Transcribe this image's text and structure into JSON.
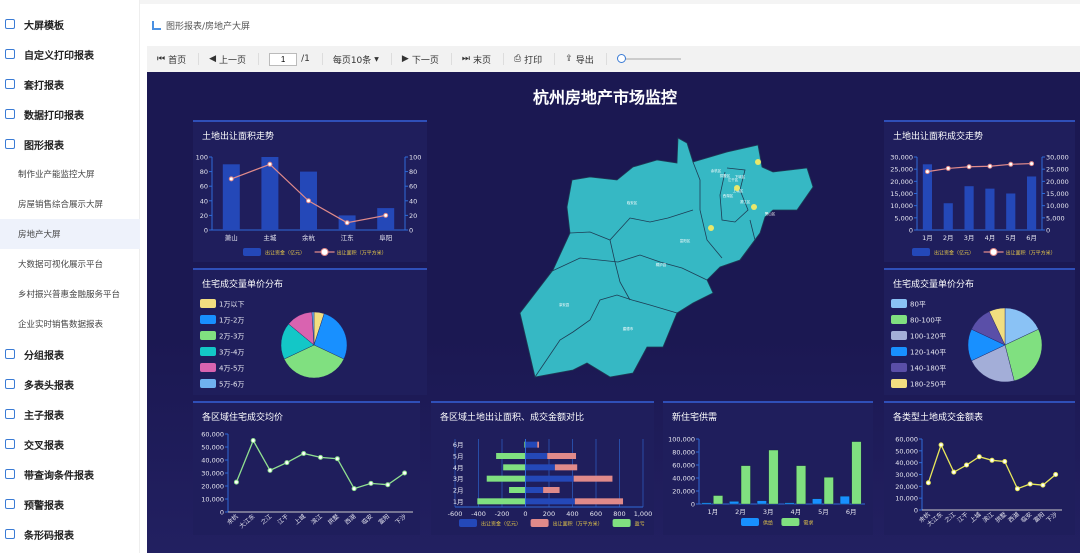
{
  "sidebar": {
    "items": [
      {
        "label": "大屏模板",
        "icon": "screen-icon"
      },
      {
        "label": "自定义打印报表",
        "icon": "refresh-icon"
      },
      {
        "label": "套打报表",
        "icon": "printer-icon"
      },
      {
        "label": "数据打印报表",
        "icon": "database-icon"
      },
      {
        "label": "图形报表",
        "icon": "bar-chart-icon"
      }
    ],
    "sub_items": [
      "制作业产能监控大屏",
      "房屋销售综合展示大屏",
      "房地产大屏",
      "大数据可视化展示平台",
      "乡村振兴普惠金融服务平台",
      "企业实时销售数据报表"
    ],
    "active_sub": "房地产大屏",
    "items2": [
      {
        "label": "分组报表",
        "icon": "group-icon"
      },
      {
        "label": "多表头报表",
        "icon": "table-icon"
      },
      {
        "label": "主子报表",
        "icon": "master-detail-icon"
      },
      {
        "label": "交叉报表",
        "icon": "shuffle-icon"
      },
      {
        "label": "带查询条件报表",
        "icon": "filter-icon"
      },
      {
        "label": "预警报表",
        "icon": "alert-icon"
      },
      {
        "label": "条形码报表",
        "icon": "barcode-icon"
      }
    ]
  },
  "breadcrumb": "图形报表/房地产大屏",
  "toolbar": {
    "first": "首页",
    "prev": "上一页",
    "page": "1",
    "total": "/1",
    "per_page": "每页10条",
    "next": "下一页",
    "last": "末页",
    "print": "打印",
    "export": "导出",
    "zoom_value": 0
  },
  "dashboard": {
    "title": "杭州房地产市场监控",
    "map": {
      "regions": [
        "临安区",
        "富阳区",
        "桐庐县",
        "淳安县",
        "建德市",
        "余杭区",
        "萧山区",
        "江干区",
        "西湖区",
        "上城区",
        "下城区",
        "拱墅区",
        "滨江区"
      ],
      "fill": "#36b8c4",
      "marker_color": "#e8e86a"
    }
  },
  "chart_data": [
    {
      "id": "c1",
      "type": "bar+line",
      "title": "土地出让面积走势",
      "categories": [
        "萧山",
        "主城",
        "余杭",
        "江东",
        "阜阳"
      ],
      "series": [
        {
          "name": "出让资金（亿元）",
          "type": "bar",
          "values": [
            90,
            100,
            80,
            20,
            30
          ],
          "color": "#2448b8"
        },
        {
          "name": "出让面积（万平方米）",
          "type": "line",
          "values": [
            70,
            90,
            40,
            10,
            20
          ],
          "color": "#e08a8a"
        }
      ],
      "ylim": [
        0,
        100
      ],
      "yticks": [
        0,
        20,
        40,
        60,
        80,
        100
      ],
      "y2ticks": [
        0,
        20,
        40,
        60,
        80,
        100
      ],
      "legend": "bottom"
    },
    {
      "id": "c2",
      "type": "pie",
      "title": "住宅成交量单价分布",
      "categories": [
        "1万以下",
        "1万-2万",
        "2万-3万",
        "3万-4万",
        "4万-5万",
        "5万-6万"
      ],
      "values": [
        5,
        27,
        36,
        18,
        13,
        1
      ],
      "colors": [
        "#f2de80",
        "#1890ff",
        "#80e080",
        "#13c7c7",
        "#d963b0",
        "#6fb2f0"
      ],
      "legend": "left"
    },
    {
      "id": "c3",
      "type": "bar+line",
      "title": "土地出让面积成交走势",
      "categories": [
        "1月",
        "2月",
        "3月",
        "4月",
        "5月",
        "6月"
      ],
      "series": [
        {
          "name": "出让资金（亿元）",
          "type": "bar",
          "values": [
            27000,
            11000,
            18000,
            17000,
            15000,
            22000
          ],
          "color": "#2448b8"
        },
        {
          "name": "出让面积（万平方米）",
          "type": "line",
          "values": [
            24000,
            25300,
            26000,
            26200,
            27000,
            27300
          ],
          "color": "#e08a8a"
        }
      ],
      "ylim": [
        0,
        30000
      ],
      "yticks": [
        "0",
        "5,000",
        "10,000",
        "15,000",
        "20,000",
        "25,000",
        "30,000"
      ],
      "y2ticks": [
        "0",
        "5,000",
        "10,000",
        "15,000",
        "20,000",
        "25,000",
        "30,000"
      ],
      "legend": "bottom"
    },
    {
      "id": "c4",
      "type": "pie",
      "title": "住宅成交量单价分布",
      "categories": [
        "80平",
        "80-100平",
        "100-120平",
        "120-140平",
        "140-180平",
        "180-250平"
      ],
      "values": [
        18,
        28,
        22,
        14,
        11,
        7
      ],
      "colors": [
        "#8ac2f5",
        "#80e080",
        "#a3aed8",
        "#1890ff",
        "#5a4fa8",
        "#f2de80"
      ],
      "legend": "left"
    },
    {
      "id": "c5",
      "type": "line",
      "title": "各区域住宅成交均价",
      "categories": [
        "余杭",
        "大江东",
        "之江",
        "江干",
        "上城",
        "滨江",
        "拱墅",
        "西湖",
        "临安",
        "富阳",
        "下沙"
      ],
      "values": [
        23000,
        55000,
        32000,
        38000,
        45000,
        42000,
        41000,
        18000,
        22000,
        21000,
        30000
      ],
      "color": "#90e090",
      "ylim": [
        0,
        60000
      ],
      "yticks": [
        "0",
        "10,000",
        "20,000",
        "30,000",
        "40,000",
        "50,000",
        "60,000"
      ]
    },
    {
      "id": "c6",
      "type": "hbar-stacked",
      "title": "各区域土地出让面积、成交金额对比",
      "categories": [
        "1月",
        "2月",
        "3月",
        "4月",
        "5月",
        "6月"
      ],
      "series": [
        {
          "name": "出让资金（亿元）",
          "values": [
            420,
            150,
            410,
            250,
            185,
            100
          ],
          "color": "#2448b8"
        },
        {
          "name": "出让面积（万平方米）",
          "values": [
            410,
            140,
            330,
            190,
            245,
            15
          ],
          "color": "#e08a8a"
        },
        {
          "name": "盈亏",
          "values": [
            -410,
            -140,
            -330,
            -190,
            -250,
            -10
          ],
          "color": "#80e080"
        }
      ],
      "xlim": [
        -600,
        1000
      ],
      "xticks": [
        "-600",
        "-400",
        "-200",
        "0",
        "200",
        "400",
        "600",
        "800",
        "1,000"
      ],
      "legend": "bottom"
    },
    {
      "id": "c7",
      "type": "bar",
      "title": "新住宅供需",
      "categories": [
        "1月",
        "2月",
        "3月",
        "4月",
        "5月",
        "6月"
      ],
      "series": [
        {
          "name": "供给",
          "values": [
            2000,
            4000,
            5000,
            2000,
            8000,
            12000
          ],
          "color": "#1890ff"
        },
        {
          "name": "需求",
          "values": [
            13000,
            59000,
            83000,
            59000,
            41000,
            96000
          ],
          "color": "#80e080"
        }
      ],
      "ylim": [
        0,
        100000
      ],
      "yticks": [
        "0",
        "20,000",
        "40,000",
        "60,000",
        "80,000",
        "100,000"
      ],
      "legend": "bottom"
    },
    {
      "id": "c8",
      "type": "line",
      "title": "各类型土地成交金额表",
      "categories": [
        "余杭",
        "大江东",
        "之江",
        "江干",
        "上城",
        "滨江",
        "拱墅",
        "西湖",
        "临安",
        "富阳",
        "下沙"
      ],
      "values": [
        23000,
        55000,
        32000,
        38000,
        45000,
        42000,
        41000,
        18000,
        22000,
        21000,
        30000
      ],
      "color": "#e8e85a",
      "ylim": [
        0,
        60000
      ],
      "yticks": [
        "0",
        "10,000",
        "20,000",
        "30,000",
        "40,000",
        "50,000",
        "60,000"
      ]
    }
  ]
}
